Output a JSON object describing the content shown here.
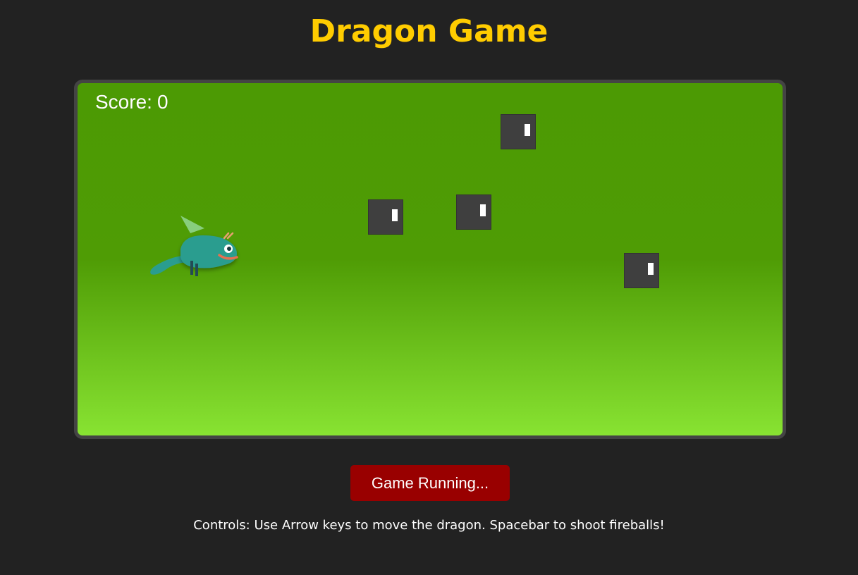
{
  "header": {
    "title": "Dragon Game"
  },
  "game": {
    "score_label": "Score:",
    "score_value": "0",
    "enemy_count": 4
  },
  "controls": {
    "button_label": "Game Running...",
    "instructions": "Controls: Use Arrow keys to move the dragon. Spacebar to shoot fireballs!"
  },
  "colors": {
    "background": "#222222",
    "title": "#ffcc00",
    "frame_border": "#444444",
    "sky_top": "#4c9a04",
    "sky_bottom": "#88e332",
    "button": "#990000",
    "dragon_body": "#2a9d8f",
    "enemy": "#3f3f3f"
  }
}
